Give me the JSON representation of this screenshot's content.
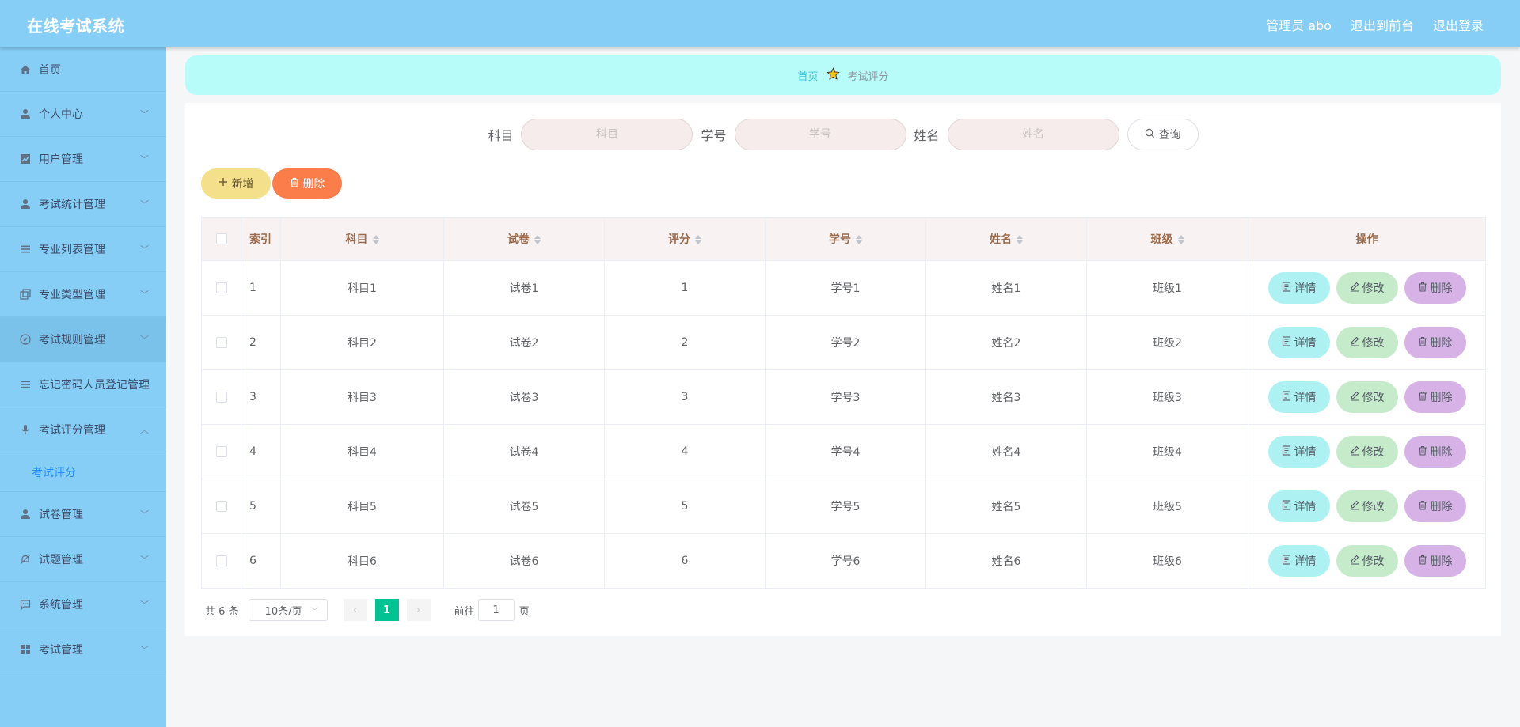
{
  "header": {
    "title": "在线考试系统",
    "user_label": "管理员 abo",
    "front_link": "退出到前台",
    "logout_link": "退出登录"
  },
  "sidebar": {
    "items": [
      {
        "label": "首页",
        "icon": "home-icon"
      },
      {
        "label": "个人中心",
        "icon": "user-icon"
      },
      {
        "label": "用户管理",
        "icon": "chart-icon"
      },
      {
        "label": "考试统计管理",
        "icon": "user-icon"
      },
      {
        "label": "专业列表管理",
        "icon": "list-icon"
      },
      {
        "label": "专业类型管理",
        "icon": "copy-icon"
      },
      {
        "label": "考试规则管理",
        "icon": "compass-icon"
      },
      {
        "label": "忘记密码人员登记管理",
        "icon": "list-icon"
      },
      {
        "label": "考试评分管理",
        "icon": "microphone-icon"
      },
      {
        "label": "试卷管理",
        "icon": "user-icon"
      },
      {
        "label": "试题管理",
        "icon": "bell-off-icon"
      },
      {
        "label": "系统管理",
        "icon": "chat-icon"
      },
      {
        "label": "考试管理",
        "icon": "grid-icon"
      }
    ],
    "submenu": {
      "label": "考试评分"
    }
  },
  "breadcrumb": {
    "home": "首页",
    "current": "考试评分"
  },
  "search": {
    "subject_label": "科目",
    "subject_placeholder": "科目",
    "student_no_label": "学号",
    "student_no_placeholder": "学号",
    "name_label": "姓名",
    "name_placeholder": "姓名",
    "button": "查询"
  },
  "actions": {
    "add": "新增",
    "delete": "删除"
  },
  "table": {
    "headers": {
      "index": "索引",
      "subject": "科目",
      "paper": "试卷",
      "score": "评分",
      "student_no": "学号",
      "name": "姓名",
      "class": "班级",
      "ops": "操作"
    },
    "rows": [
      {
        "index": "1",
        "subject": "科目1",
        "paper": "试卷1",
        "score": "1",
        "student_no": "学号1",
        "name": "姓名1",
        "class": "班级1"
      },
      {
        "index": "2",
        "subject": "科目2",
        "paper": "试卷2",
        "score": "2",
        "student_no": "学号2",
        "name": "姓名2",
        "class": "班级2"
      },
      {
        "index": "3",
        "subject": "科目3",
        "paper": "试卷3",
        "score": "3",
        "student_no": "学号3",
        "name": "姓名3",
        "class": "班级3"
      },
      {
        "index": "4",
        "subject": "科目4",
        "paper": "试卷4",
        "score": "4",
        "student_no": "学号4",
        "name": "姓名4",
        "class": "班级4"
      },
      {
        "index": "5",
        "subject": "科目5",
        "paper": "试卷5",
        "score": "5",
        "student_no": "学号5",
        "name": "姓名5",
        "class": "班级5"
      },
      {
        "index": "6",
        "subject": "科目6",
        "paper": "试卷6",
        "score": "6",
        "student_no": "学号6",
        "name": "姓名6",
        "class": "班级6"
      }
    ],
    "row_buttons": {
      "detail": "详情",
      "edit": "修改",
      "delete": "删除"
    }
  },
  "pagination": {
    "total": "共 6 条",
    "page_size": "10条/页",
    "current_page": "1",
    "goto_label": "前往",
    "goto_value": "1",
    "page_suffix": "页"
  },
  "colors": {
    "header_bg": "#87cef7",
    "sidebar_bg": "#87cef7",
    "breadcrumb_bg": "#b8fcfa",
    "add_button": "#f4e08a",
    "delete_button": "#fb7d4a",
    "detail_button": "#aef1f3",
    "edit_button": "#c5ebcb",
    "remove_button": "#d6b2e6",
    "active_page": "#00c292"
  }
}
